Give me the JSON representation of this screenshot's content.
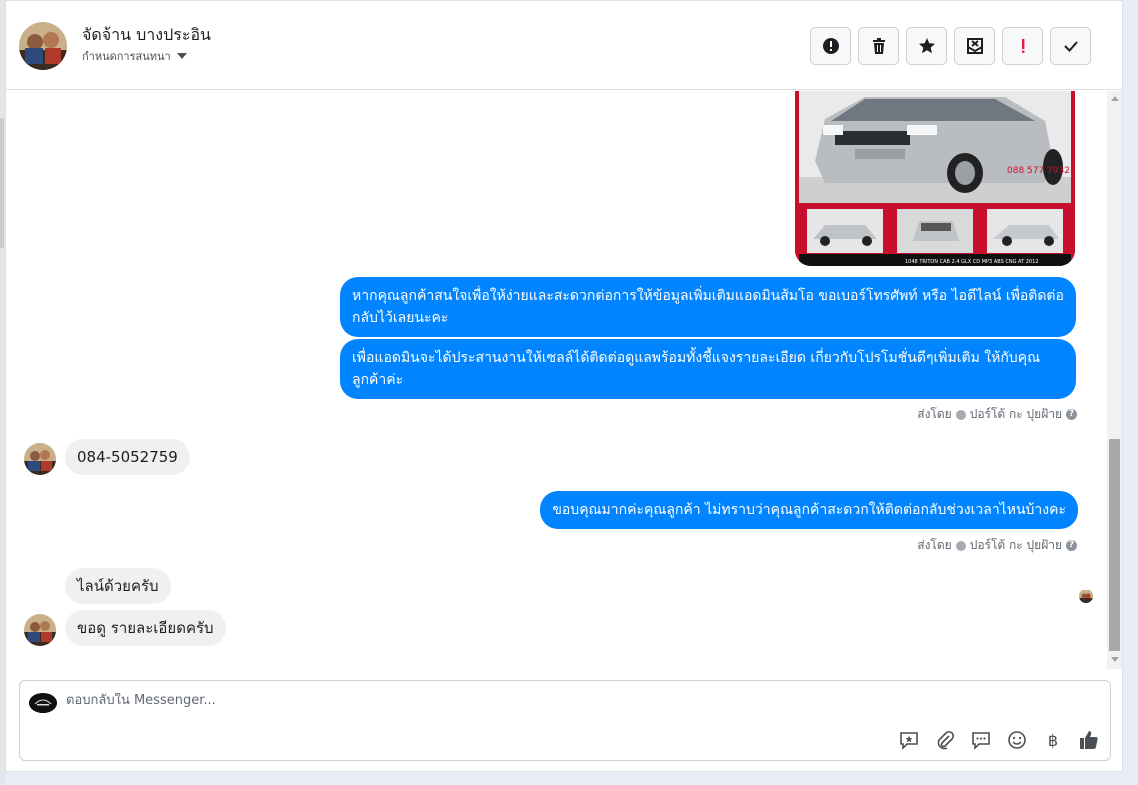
{
  "header": {
    "contact_name": "จัดจ้าน บางประอิน",
    "assign_label": "กำหนดการสนทนา",
    "actions": [
      {
        "name": "spam-button",
        "icon": "alert-circle-icon"
      },
      {
        "name": "delete-button",
        "icon": "trash-icon"
      },
      {
        "name": "star-button",
        "icon": "star-icon"
      },
      {
        "name": "mark-unread-button",
        "icon": "envelope-x-icon"
      },
      {
        "name": "follow-up-button",
        "icon": "exclamation-icon"
      },
      {
        "name": "done-button",
        "icon": "check-icon"
      }
    ]
  },
  "messages": {
    "car_image_caption": "1048 TRITON CAB 2.4 GLX CD MP3 ABS CNG AT 2012",
    "car_image_phone": "088 577 7932",
    "out_1": "หากคุณลูกค้าสนใจเพื่อให้ง่ายและสะดวกต่อการให้ข้อมูลเพิ่มเติมแอดมินส้มโอ ขอเบอร์โทรศัพท์ หรือ ไอดีไลน์ เพื่อติดต่อกลับไว้เลยนะคะ",
    "out_2": "เพื่อแอดมินจะได้ประสานงานให้เซลล์ได้ติดต่อดูแลพร้อมทั้งชี้แจงรายละเอียด เกี่ยวกับโปรโมชั่นดีๆเพิ่มเติม ให้กับคุณลูกค้าค่ะ",
    "sent_by_1": "ส่งโดย",
    "sender_1": "ปอร์โต้ กะ ปุยฝ้าย",
    "in_1": "084-5052759",
    "out_3": "ขอบคุณมากค่ะคุณลูกค้า ไม่ทราบว่าคุณลูกค้าสะดวกให้ติดต่อกลับช่วงเวลาไหนบ้างคะ",
    "sent_by_2": "ส่งโดย",
    "sender_2": "ปอร์โต้ กะ ปุยฝ้าย",
    "in_2": "ไลน์ด้วยครับ",
    "in_3": "ขอดู รายละเอียดครับ"
  },
  "composer": {
    "placeholder": "ตอบกลับใน Messenger...",
    "tools": [
      "saved-reply-icon",
      "attachment-icon",
      "chat-bubble-icon",
      "emoji-icon",
      "baht-icon",
      "thumbs-up-icon"
    ],
    "baht_glyph": "฿"
  },
  "colors": {
    "accent": "#0084ff",
    "incoming_bubble": "#f1f0f0",
    "follow_up_red": "#e41e3f"
  }
}
